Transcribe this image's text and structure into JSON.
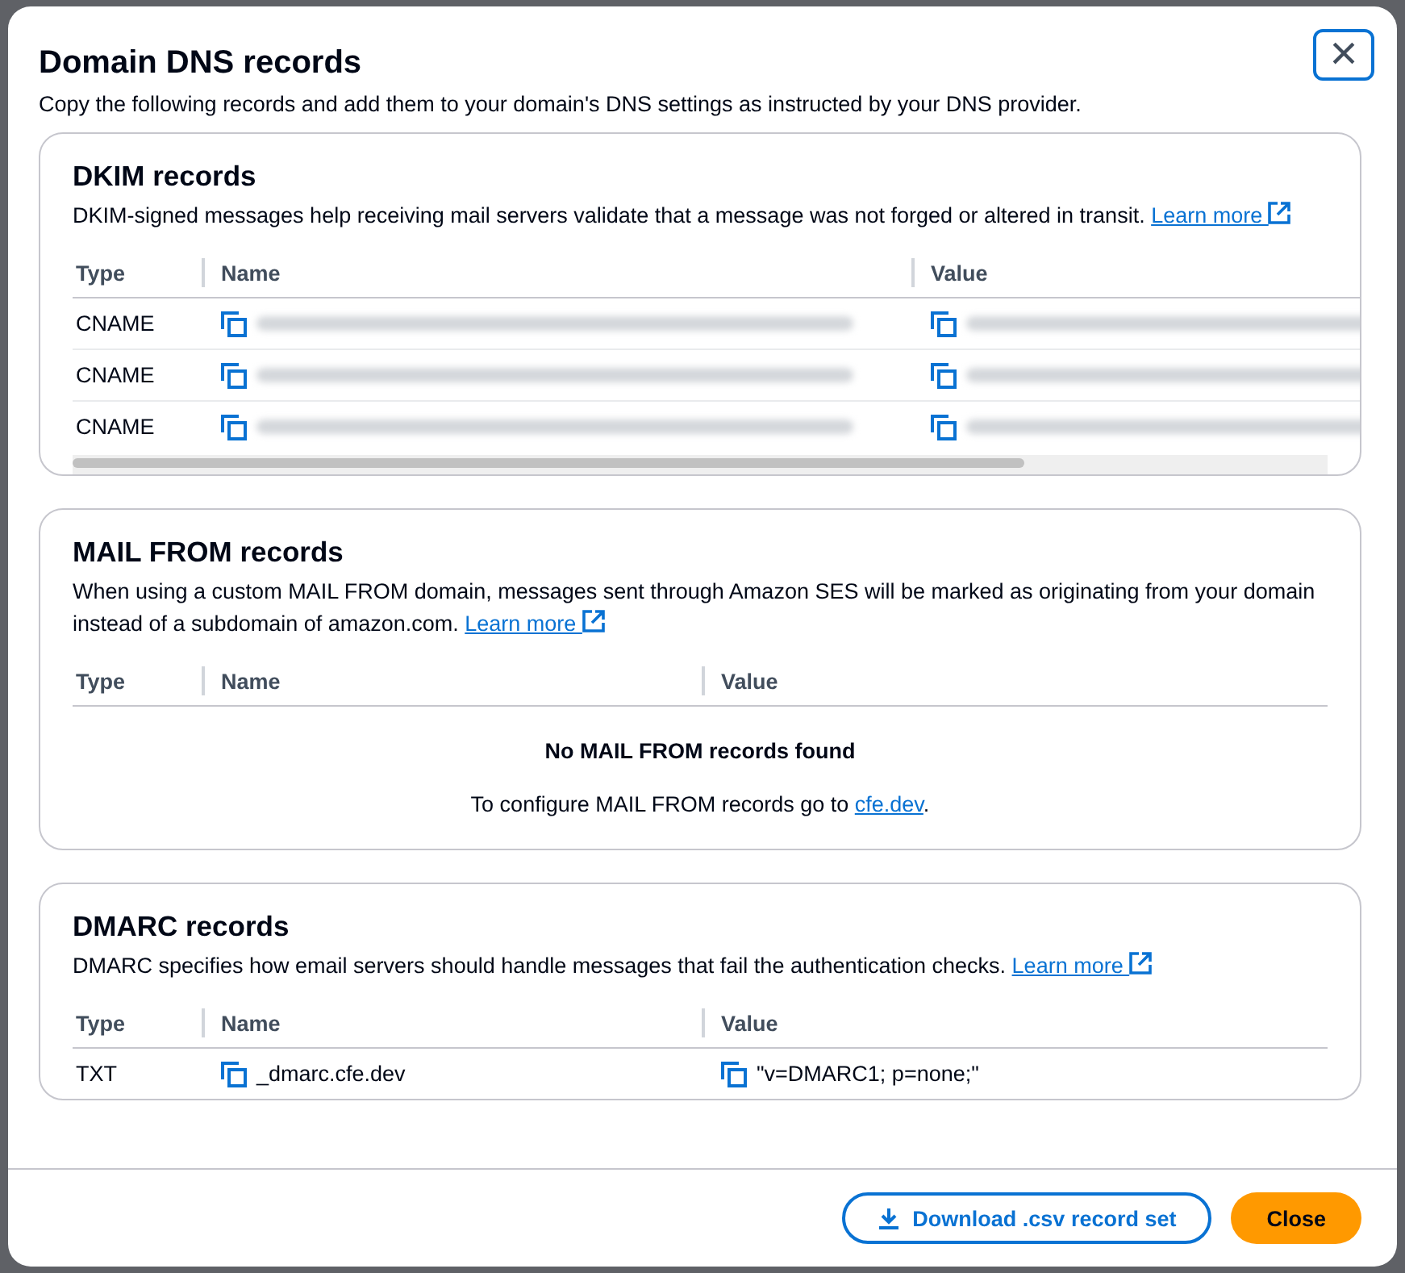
{
  "dialog": {
    "title": "Domain DNS records",
    "description": "Copy the following records and add them to your domain's DNS settings as instructed by your DNS provider.",
    "close_icon": "×"
  },
  "sections": [
    {
      "kind": "table",
      "title": "DKIM records",
      "description": "DKIM-signed messages help receiving mail servers validate that a message was not forged or altered in transit.",
      "link": "Learn more",
      "columns": [
        "Type",
        "Name",
        "Value"
      ],
      "scrollbar": true,
      "rows": [
        {
          "type": "CNAME",
          "name_redacted": true,
          "value_redacted": true
        },
        {
          "type": "CNAME",
          "name_redacted": true,
          "value_redacted": true
        },
        {
          "type": "CNAME",
          "name_redacted": true,
          "value_redacted": true
        }
      ]
    },
    {
      "kind": "empty",
      "title": "MAIL FROM records",
      "description": "When using a custom MAIL FROM domain, messages sent through Amazon SES will be marked as originating from your domain instead of a subdomain of amazon.com.",
      "link": "Learn more",
      "columns": [
        "Type",
        "Name",
        "Value"
      ],
      "empty_title": "No MAIL FROM records found",
      "empty_text": "To configure MAIL FROM records go to",
      "empty_link": "cfe.dev",
      "empty_end": "."
    },
    {
      "kind": "table",
      "title": "DMARC records",
      "description": "DMARC specifies how email servers should handle messages that fail the authentication checks.",
      "link": "Learn more",
      "columns": [
        "Type",
        "Name",
        "Value"
      ],
      "scrollbar": false,
      "rows": [
        {
          "type": "TXT",
          "name": "_dmarc.cfe.dev",
          "value": "\"v=DMARC1; p=none;\""
        }
      ]
    }
  ],
  "footer": {
    "download": "Download .csv record set",
    "close": "Close"
  }
}
